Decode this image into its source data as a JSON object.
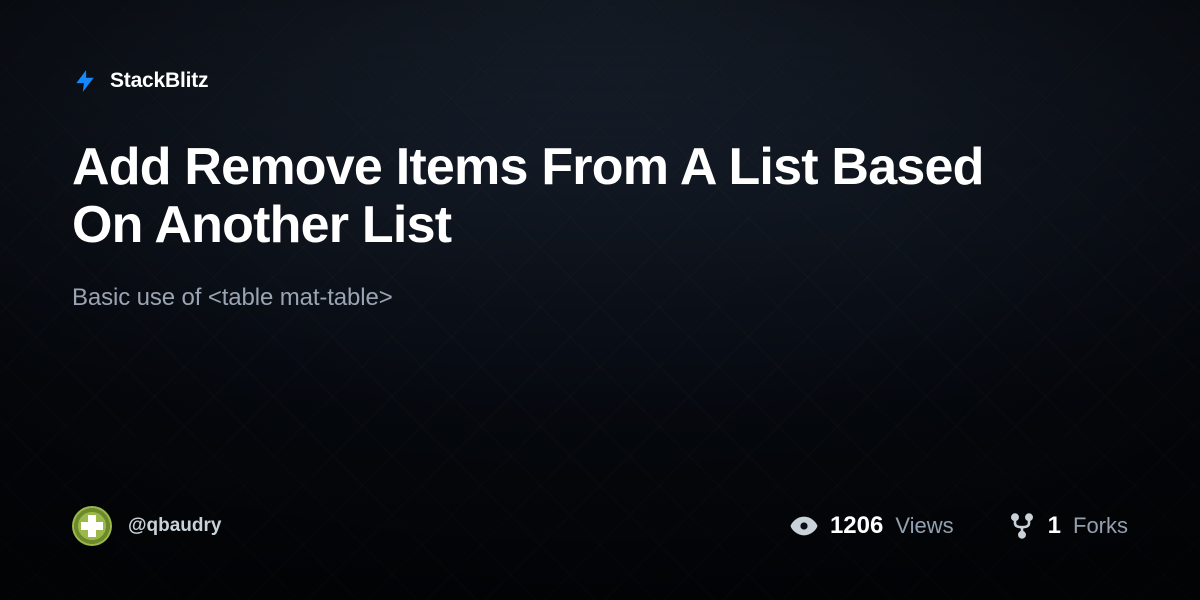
{
  "brand": {
    "name": "StackBlitz",
    "icon": "bolt-icon",
    "accentColor": "#1389fd"
  },
  "project": {
    "title": "Add Remove Items From A List Based On Another List",
    "description": "Basic use of <table mat-table>"
  },
  "author": {
    "handle": "@qbaudry"
  },
  "stats": {
    "views": {
      "value": "1206",
      "label": "Views"
    },
    "forks": {
      "value": "1",
      "label": "Forks"
    }
  }
}
